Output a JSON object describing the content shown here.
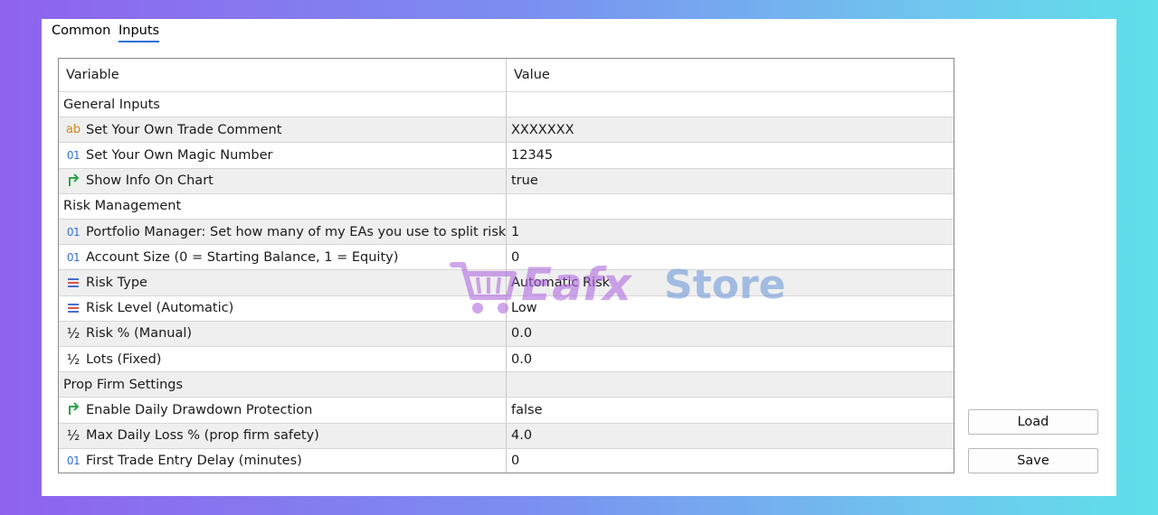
{
  "tabs": [
    {
      "label": "Common",
      "active": false
    },
    {
      "label": "Inputs",
      "active": true
    }
  ],
  "grid": {
    "headers": {
      "variable": "Variable",
      "value": "Value"
    },
    "rows": [
      {
        "type": "section",
        "label": "General Inputs"
      },
      {
        "type": "param",
        "icon": "string-ab-icon",
        "label": "Set Your Own Trade Comment",
        "value": "XXXXXXX"
      },
      {
        "type": "param",
        "icon": "integer-01-icon",
        "label": "Set Your Own Magic Number",
        "value": "12345"
      },
      {
        "type": "param",
        "icon": "boolean-arrow-icon",
        "label": "Show Info On Chart",
        "value": "true"
      },
      {
        "type": "section",
        "label": "Risk Management"
      },
      {
        "type": "param",
        "icon": "integer-01-icon",
        "label": "Portfolio Manager: Set how many of my EAs you use to split risk",
        "value": "1"
      },
      {
        "type": "param",
        "icon": "integer-01-icon",
        "label": "Account Size (0 = Starting Balance, 1 = Equity)",
        "value": "0"
      },
      {
        "type": "param",
        "icon": "enum-list-icon",
        "label": "Risk Type",
        "value": "Automatic Risk"
      },
      {
        "type": "param",
        "icon": "enum-list-icon",
        "label": "Risk Level (Automatic)",
        "value": "Low"
      },
      {
        "type": "param",
        "icon": "double-half-icon",
        "label": "Risk % (Manual)",
        "value": "0.0"
      },
      {
        "type": "param",
        "icon": "double-half-icon",
        "label": "Lots (Fixed)",
        "value": "0.0"
      },
      {
        "type": "section",
        "label": "Prop Firm Settings"
      },
      {
        "type": "param",
        "icon": "boolean-arrow-icon",
        "label": "Enable Daily Drawdown Protection",
        "value": "false"
      },
      {
        "type": "param",
        "icon": "double-half-icon",
        "label": "Max Daily Loss % (prop firm safety)",
        "value": "4.0"
      },
      {
        "type": "param",
        "icon": "integer-01-icon",
        "label": "First Trade Entry Delay (minutes)",
        "value": "0"
      }
    ]
  },
  "buttons": {
    "load": "Load",
    "save": "Save"
  },
  "watermark": {
    "word1": "Eafx",
    "word2": "Store"
  },
  "colors": {
    "tab_underline": "#2a6fd1",
    "alt_row": "#efefef",
    "icon_string": "#c98a22",
    "icon_integer": "#2f6fd6",
    "icon_boolean": "#2aa34a"
  }
}
